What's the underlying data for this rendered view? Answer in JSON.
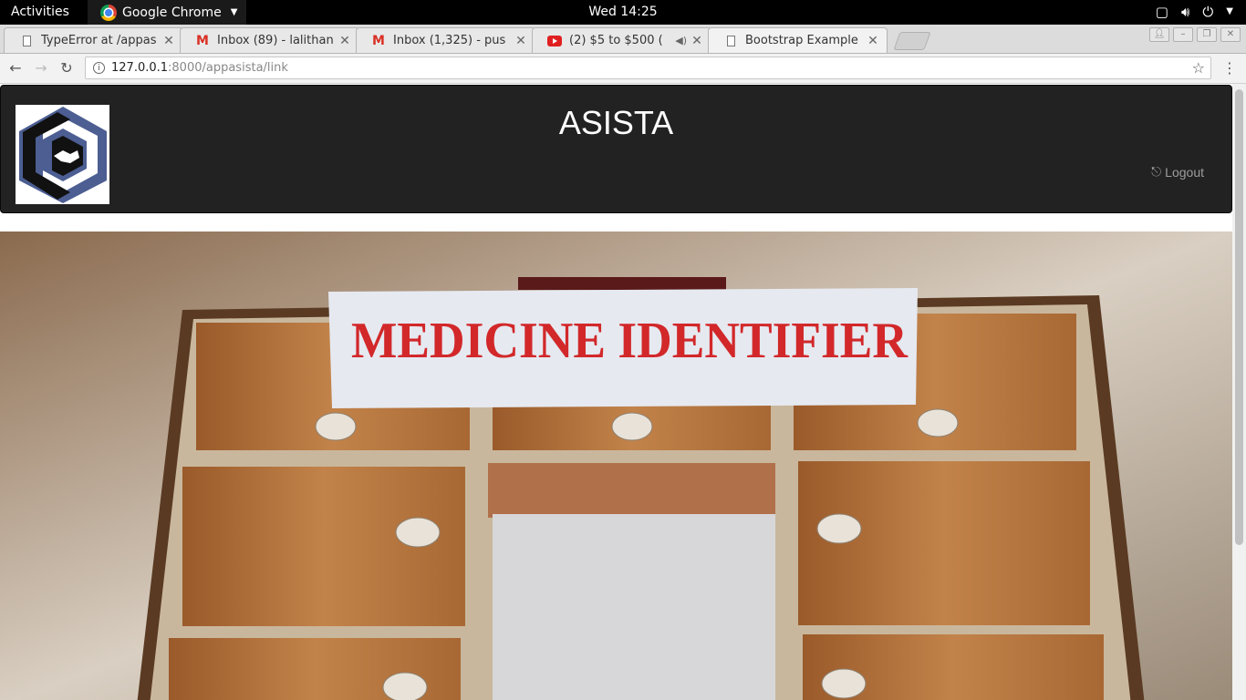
{
  "system_bar": {
    "activities": "Activities",
    "app_name": "Google Chrome",
    "clock": "Wed 14:25"
  },
  "browser": {
    "tabs": [
      {
        "title": "TypeError at /appas",
        "icon": "document-icon"
      },
      {
        "title": "Inbox (89) - lalithan",
        "icon": "gmail-icon"
      },
      {
        "title": "Inbox (1,325) - pus",
        "icon": "gmail-icon"
      },
      {
        "title": "(2) $5 to $500 (",
        "icon": "youtube-icon",
        "audio": true
      },
      {
        "title": "Bootstrap Example",
        "icon": "document-icon",
        "active": true
      }
    ],
    "url_host": "127.0.0.1",
    "url_rest": ":8000/appasista/link"
  },
  "site": {
    "brand": "ASISTA",
    "logout_label": "Logout",
    "hero_sign_text": "MEDICINE IDENTIFIER"
  },
  "colors": {
    "navbar_bg": "#222222",
    "logo_blue": "#4c5e92",
    "sign_red": "#d2282a",
    "wood": "#b0703a"
  }
}
